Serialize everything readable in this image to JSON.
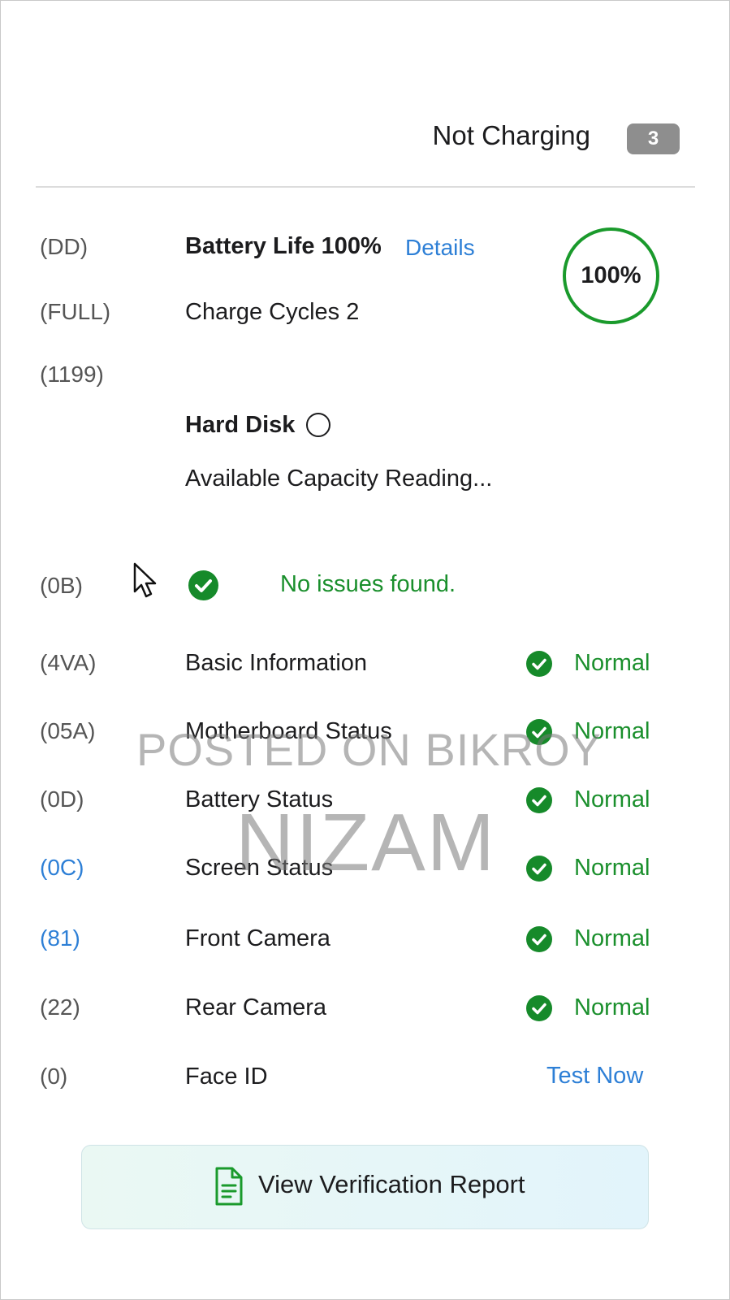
{
  "header": {
    "status_text": "Not Charging",
    "badge_count": "3"
  },
  "battery": {
    "life_label": "Battery Life 100%",
    "details_link": "Details",
    "cycles_label": "Charge Cycles 2",
    "ring_percent": "100%",
    "ring_color": "#1a9a2c",
    "codes": [
      "(DD)",
      "(FULL)",
      "(1199)"
    ]
  },
  "hard_disk": {
    "title": "Hard Disk",
    "capacity_text": "Available Capacity Reading..."
  },
  "summary": {
    "code": "(0B)",
    "message": "No issues found.",
    "icon": "check-circle-icon"
  },
  "checks": [
    {
      "code": "(4VA)",
      "label": "Basic Information",
      "status": "Normal"
    },
    {
      "code": "(05A)",
      "label": "Motherboard Status",
      "status": "Normal"
    },
    {
      "code": "(0D)",
      "label": "Battery Status",
      "status": "Normal"
    },
    {
      "code": "(0C)",
      "label": "Screen Status",
      "status": "Normal"
    },
    {
      "code": "(81)",
      "label": "Front Camera",
      "status": "Normal"
    },
    {
      "code": "(22)",
      "label": "Rear Camera",
      "status": "Normal"
    }
  ],
  "face_id": {
    "code": "(0)",
    "label": "Face ID",
    "action": "Test Now"
  },
  "report_button": {
    "label": "View Verification Report",
    "icon": "document-icon"
  },
  "watermark": {
    "line1": "POSTED ON BIKROY",
    "line2": "NIZAM"
  },
  "colors": {
    "accent_blue": "#2d7fd6",
    "status_green": "#1a8f2c",
    "badge_gray": "#8e8e8e"
  }
}
